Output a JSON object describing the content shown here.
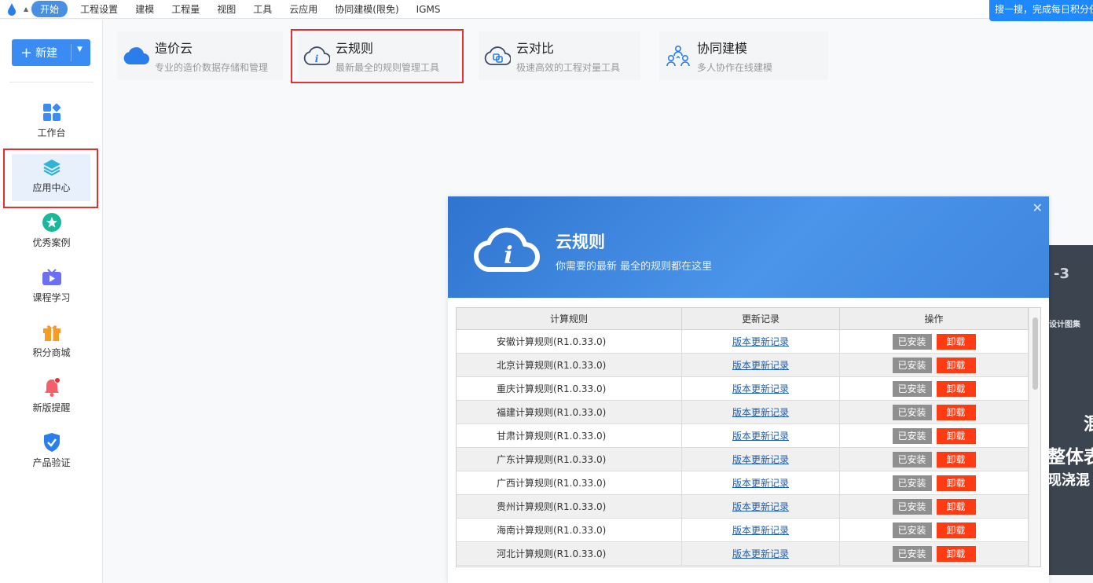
{
  "menubar": {
    "items": [
      "开始",
      "工程设置",
      "建模",
      "工程量",
      "视图",
      "工具",
      "云应用",
      "协同建模(限免)",
      "IGMS"
    ],
    "promo": "搜一搜，完成每日积分任务"
  },
  "sidebar": {
    "new_button": "新建",
    "items": [
      {
        "label": "工作台",
        "icon": "grid-icon"
      },
      {
        "label": "应用中心",
        "icon": "layers-icon"
      },
      {
        "label": "优秀案例",
        "icon": "star-icon"
      },
      {
        "label": "课程学习",
        "icon": "tv-icon"
      },
      {
        "label": "积分商城",
        "icon": "gift-icon"
      },
      {
        "label": "新版提醒",
        "icon": "bell-icon"
      },
      {
        "label": "产品验证",
        "icon": "shield-check-icon"
      }
    ]
  },
  "tiles": [
    {
      "title": "造价云",
      "subtitle": "专业的造价数据存储和管理",
      "icon": "cloud-icon"
    },
    {
      "title": "云规则",
      "subtitle": "最新最全的规则管理工具",
      "icon": "cloud-info-icon"
    },
    {
      "title": "云对比",
      "subtitle": "极速高效的工程对量工具",
      "icon": "cloud-compare-icon"
    },
    {
      "title": "协同建模",
      "subtitle": "多人协作在线建模",
      "icon": "people-icon"
    }
  ],
  "dialog": {
    "title": "云规则",
    "subtitle": "你需要的最新 最全的规则都在这里",
    "columns": [
      "计算规则",
      "更新记录",
      "操作"
    ],
    "rows": [
      {
        "rule": "安徽计算规则(R1.0.33.0)",
        "log": "版本更新记录",
        "installed": "已安装",
        "uninstall": "卸载"
      },
      {
        "rule": "北京计算规则(R1.0.33.0)",
        "log": "版本更新记录",
        "installed": "已安装",
        "uninstall": "卸载"
      },
      {
        "rule": "重庆计算规则(R1.0.33.0)",
        "log": "版本更新记录",
        "installed": "已安装",
        "uninstall": "卸载"
      },
      {
        "rule": "福建计算规则(R1.0.33.0)",
        "log": "版本更新记录",
        "installed": "已安装",
        "uninstall": "卸载"
      },
      {
        "rule": "甘肃计算规则(R1.0.33.0)",
        "log": "版本更新记录",
        "installed": "已安装",
        "uninstall": "卸载"
      },
      {
        "rule": "广东计算规则(R1.0.33.0)",
        "log": "版本更新记录",
        "installed": "已安装",
        "uninstall": "卸载"
      },
      {
        "rule": "广西计算规则(R1.0.33.0)",
        "log": "版本更新记录",
        "installed": "已安装",
        "uninstall": "卸载"
      },
      {
        "rule": "贵州计算规则(R1.0.33.0)",
        "log": "版本更新记录",
        "installed": "已安装",
        "uninstall": "卸载"
      },
      {
        "rule": "海南计算规则(R1.0.33.0)",
        "log": "版本更新记录",
        "installed": "已安装",
        "uninstall": "卸载"
      },
      {
        "rule": "河北计算规则(R1.0.33.0)",
        "log": "版本更新记录",
        "installed": "已安装",
        "uninstall": "卸载"
      }
    ]
  },
  "background_peek": {
    "lines": [
      "-3",
      "设计图集",
      "混",
      "整体表",
      "现浇混"
    ]
  },
  "colors": {
    "accent": "#3a8cf2",
    "danger": "#ff3b14",
    "highlight_box": "#e5302f",
    "muted_button": "#8f8f8f"
  }
}
